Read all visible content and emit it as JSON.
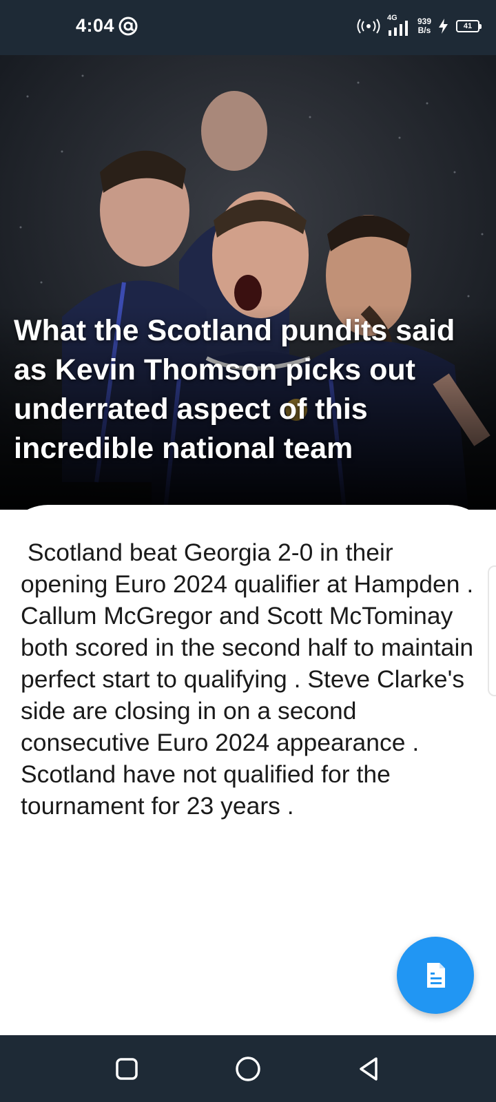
{
  "status_bar": {
    "time": "4:04",
    "network_type": "4G",
    "speed_value": "939",
    "speed_unit": "B/s",
    "battery_level": "41",
    "icons": [
      "at-sign-icon",
      "hotspot-icon",
      "signal-icon",
      "charging-bolt-icon",
      "battery-icon"
    ]
  },
  "article": {
    "headline": "What the Scotland pundits said as Kevin Thomson picks out underrated aspect of this incredible national team",
    "summary": " Scotland beat Georgia 2-0 in their opening Euro 2024 qualifier at Hampden . Callum McGregor and Scott McTominay both scored in the second half to maintain perfect start to qualifying . Steve Clarke's side are closing in on a second consecutive Euro 2024 appearance . Scotland have not qualified for the tournament for 23 years ."
  },
  "fab": {
    "icon": "document-icon",
    "color": "#2196f3"
  },
  "nav": {
    "buttons": [
      "recents-square-icon",
      "home-circle-icon",
      "back-triangle-icon"
    ]
  },
  "colors": {
    "system_bars": "#1e2a36",
    "accent": "#2196f3"
  }
}
